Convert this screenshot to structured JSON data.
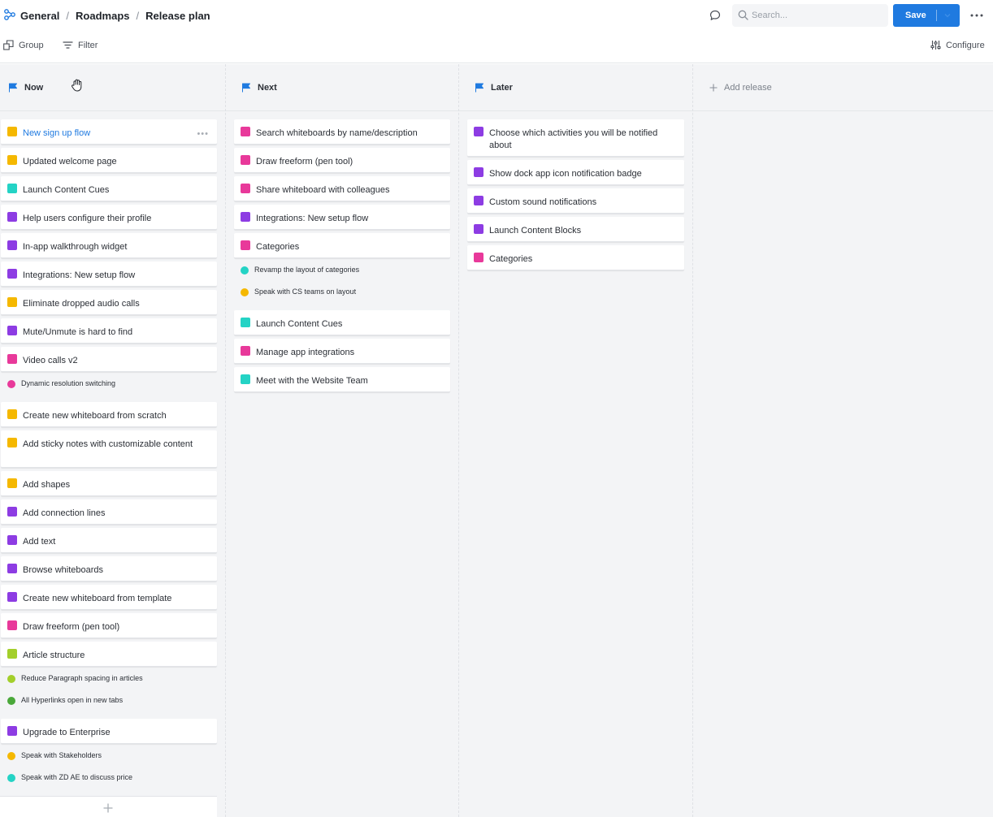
{
  "breadcrumb": {
    "items": [
      "General",
      "Roadmaps",
      "Release plan"
    ],
    "separator": "/"
  },
  "search": {
    "placeholder": "Search...",
    "value": ""
  },
  "save_button": {
    "label": "Save"
  },
  "toolbar": {
    "group_label": "Group",
    "filter_label": "Filter",
    "configure_label": "Configure"
  },
  "colors": {
    "yellow": "#f5b800",
    "teal": "#24d3c5",
    "purple": "#8d3ce3",
    "pink": "#e8399a",
    "lime": "#a3cf2b",
    "green": "#4aa83a",
    "accent": "#1f7ae0"
  },
  "add_release_label": "Add release",
  "columns": [
    {
      "title": "Now",
      "items": [
        {
          "text": "New sign up flow",
          "color": "yellow",
          "link": true,
          "more": "•••"
        },
        {
          "text": "Updated welcome page",
          "color": "yellow"
        },
        {
          "text": "Launch Content Cues",
          "color": "teal"
        },
        {
          "text": "Help users configure their profile",
          "color": "purple"
        },
        {
          "text": "In-app walkthrough widget",
          "color": "purple"
        },
        {
          "text": "Integrations: New setup flow",
          "color": "purple"
        },
        {
          "text": "Eliminate dropped audio calls",
          "color": "yellow"
        },
        {
          "text": "Mute/Unmute is hard to find",
          "color": "purple"
        },
        {
          "text": "Video calls v2",
          "color": "pink",
          "subs": [
            {
              "text": "Dynamic resolution switching",
              "color": "pink"
            }
          ]
        },
        {
          "text": "Create new whiteboard from scratch",
          "color": "yellow"
        },
        {
          "text": "Add sticky notes with customizable content",
          "color": "yellow",
          "tall": true
        },
        {
          "text": "Add shapes",
          "color": "yellow"
        },
        {
          "text": "Add connection lines",
          "color": "purple"
        },
        {
          "text": "Add text",
          "color": "purple"
        },
        {
          "text": "Browse whiteboards",
          "color": "purple"
        },
        {
          "text": "Create new whiteboard from template",
          "color": "purple"
        },
        {
          "text": "Draw freeform (pen tool)",
          "color": "pink"
        },
        {
          "text": "Article structure",
          "color": "lime",
          "subs": [
            {
              "text": "Reduce Paragraph spacing in articles",
              "color": "lime"
            },
            {
              "text": "All Hyperlinks open in new tabs",
              "color": "green"
            }
          ]
        },
        {
          "text": "Upgrade to Enterprise",
          "color": "purple",
          "subs": [
            {
              "text": "Speak with Stakeholders",
              "color": "yellow"
            },
            {
              "text": "Speak with ZD AE to discuss price",
              "color": "teal"
            }
          ]
        }
      ]
    },
    {
      "title": "Next",
      "items": [
        {
          "text": "Search whiteboards by name/description",
          "color": "pink"
        },
        {
          "text": "Draw freeform (pen tool)",
          "color": "pink"
        },
        {
          "text": "Share whiteboard with colleagues",
          "color": "pink"
        },
        {
          "text": "Integrations: New setup flow",
          "color": "purple"
        },
        {
          "text": "Categories",
          "color": "pink",
          "subs": [
            {
              "text": "Revamp the layout of categories",
              "color": "teal"
            },
            {
              "text": "Speak with CS teams on layout",
              "color": "yellow"
            }
          ]
        },
        {
          "text": "Launch Content Cues",
          "color": "teal"
        },
        {
          "text": "Manage app integrations",
          "color": "pink"
        },
        {
          "text": "Meet with the Website Team",
          "color": "teal"
        }
      ]
    },
    {
      "title": "Later",
      "items": [
        {
          "text": "Choose which activities you will be notified about",
          "color": "purple",
          "tall": true
        },
        {
          "text": "Show dock app icon notification badge",
          "color": "purple"
        },
        {
          "text": "Custom sound notifications",
          "color": "purple"
        },
        {
          "text": "Launch Content Blocks",
          "color": "purple"
        },
        {
          "text": "Categories",
          "color": "pink"
        }
      ]
    }
  ]
}
